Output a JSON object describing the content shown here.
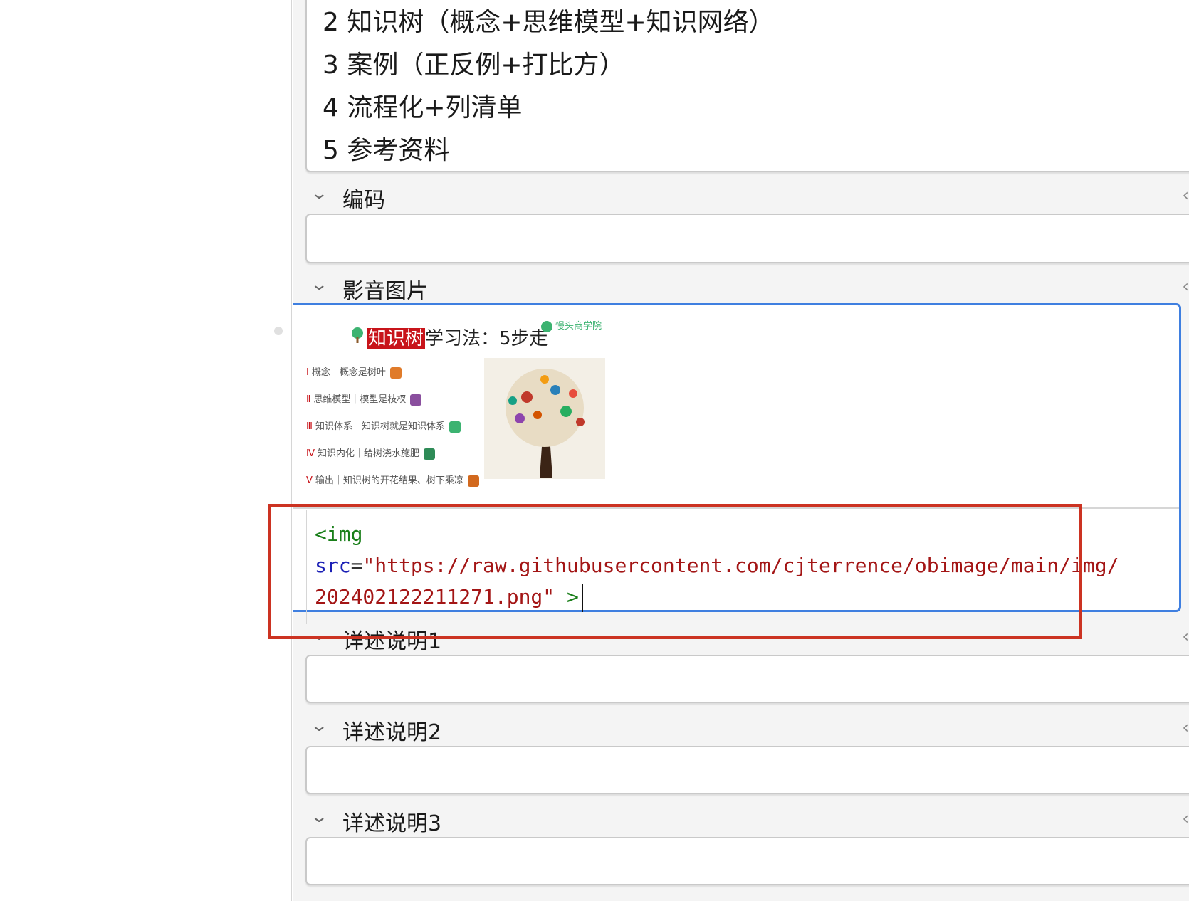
{
  "top_field": {
    "lines": [
      "2 知识树（概念+思维模型+知识网络）",
      "3 案例（正反例+打比方）",
      "4 流程化+列清单",
      "5 参考资料"
    ]
  },
  "fields": {
    "encoding": {
      "label": "编码"
    },
    "media": {
      "label": "影音图片"
    },
    "detail1": {
      "label": "详述说明1"
    },
    "detail2": {
      "label": "详述说明2"
    },
    "detail3": {
      "label": "详述说明3"
    }
  },
  "media_embed": {
    "title_highlight": "知识树",
    "title_rest": "学习法：5步走",
    "brand": "慢头商学院",
    "steps": [
      {
        "num": "Ⅰ",
        "text": "概念｜概念是树叶"
      },
      {
        "num": "Ⅱ",
        "text": "思维模型｜模型是枝杈"
      },
      {
        "num": "Ⅲ",
        "text": "知识体系｜知识树就是知识体系"
      },
      {
        "num": "Ⅳ",
        "text": "知识内化｜给树浇水施肥"
      },
      {
        "num": "Ⅴ",
        "text": "输出｜知识树的开花结果、树下乘凉"
      }
    ]
  },
  "code": {
    "tag_open": "<img",
    "attr": "src",
    "eq": "=",
    "url_line1": "\"https://raw.githubusercontent.com/cjterrence/obimage/main/img/",
    "url_line2": "202402122211271.png\"",
    "tag_close": " >"
  },
  "icons": {
    "chevron": "chevron-down-icon",
    "pin": "pin-icon"
  },
  "colors": {
    "focus_border": "#3f7fe0",
    "annotation": "#cc3322",
    "highlight": "#c8141a"
  }
}
